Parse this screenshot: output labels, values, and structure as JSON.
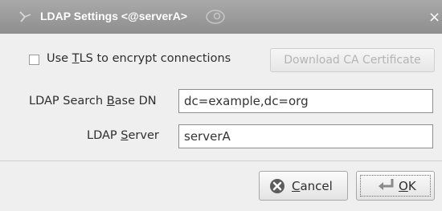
{
  "titlebar": {
    "title": "LDAP Settings <@serverA>",
    "close_glyph": "×"
  },
  "form": {
    "tls_checkbox": {
      "checked": false,
      "label_pre": "Use ",
      "label_mnemonic": "T",
      "label_post": "LS to encrypt connections"
    },
    "download_button_label": "Download CA Certificate",
    "base_dn": {
      "label_pre": "LDAP Search ",
      "label_mnemonic": "B",
      "label_post": "ase DN",
      "value": "dc=example,dc=org"
    },
    "server": {
      "label_pre": "LDAP ",
      "label_mnemonic": "S",
      "label_post": "erver",
      "value": "serverA"
    }
  },
  "buttons": {
    "cancel": {
      "mnemonic": "C",
      "rest": "ancel"
    },
    "ok": {
      "mnemonic": "O",
      "rest": "K"
    }
  },
  "icons": {
    "title": "window-menu-icon",
    "title_decoration": "suse-swirl-icon",
    "close": "close-icon",
    "cancel": "cancel-icon",
    "ok": "ok-return-icon"
  }
}
